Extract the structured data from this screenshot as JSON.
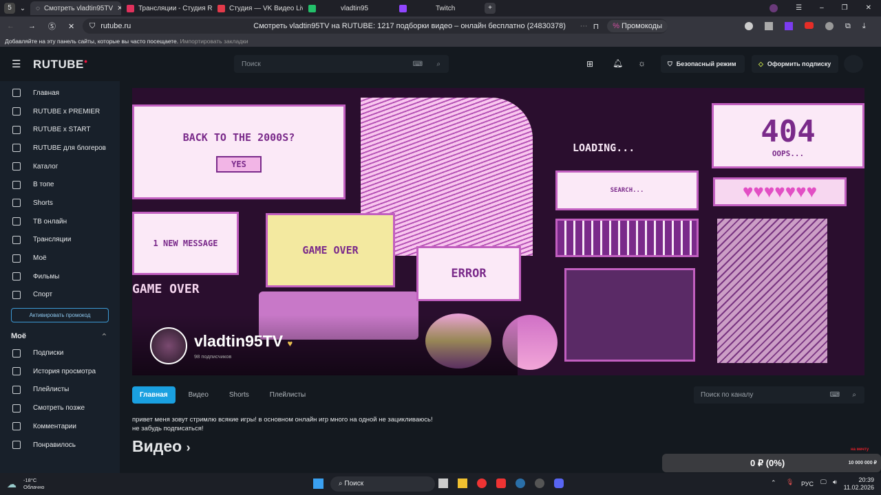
{
  "browser": {
    "tab_count": "5",
    "tabs": [
      {
        "label": "Смотреть vladtin95TV",
        "color": "#ffffff"
      },
      {
        "label": "Трансляции - Студия RUTUBE",
        "color": "#e0315c"
      },
      {
        "label": "Студия — VK Видео Live",
        "color": "#e33a4a"
      },
      {
        "label": "vladtin95",
        "color": "#23c06a"
      },
      {
        "label": "Twitch",
        "color": "#9146ff"
      }
    ],
    "url": "rutube.ru",
    "page_title": "Смотреть vladtin95TV на RUTUBE: 1217 подборки видео – онлайн бесплатно (24830378)",
    "promo": "Промокоды",
    "bookmarks_hint": "Добавляйте на эту панель сайты, которые вы часто посещаете.",
    "import_link": "Импортировать закладки"
  },
  "header": {
    "logo": "RUTUBE",
    "search_placeholder": "Поиск",
    "safe_mode": "Безопасный режим",
    "subscribe": "Оформить подписку"
  },
  "sidebar": {
    "items": [
      "Главная",
      "RUTUBE x PREMIER",
      "RUTUBE x START",
      "RUTUBE для блогеров",
      "Каталог",
      "В топе",
      "Shorts",
      "ТВ онлайн",
      "Трансляции",
      "Моё",
      "Фильмы",
      "Спорт"
    ],
    "promo_button": "Активировать промокод",
    "my_title": "Моё",
    "my_items": [
      "Подписки",
      "История просмотра",
      "Плейлисты",
      "Смотреть позже",
      "Комментарии",
      "Понравилось"
    ]
  },
  "banner": {
    "back": "BACK TO THE 2000S?",
    "yes": "YES",
    "loading": "LOADING...",
    "e404": "404",
    "oops": "OOPS...",
    "search": "SEARCH...",
    "message": "1 NEW MESSAGE",
    "game_over": "GAME OVER",
    "error": "ERROR"
  },
  "channel": {
    "name": "vladtin95TV",
    "subscribers": "98 подписчиков",
    "tabs": [
      "Главная",
      "Видео",
      "Shorts",
      "Плейлисты"
    ],
    "search_placeholder": "Поиск по каналу",
    "description_1": "привет меня зовут стримлю всякие игры! в основном онлайн игр много на одной не зацикливаюсь!",
    "description_2": "не забудь подписаться!",
    "videos_heading": "Видео"
  },
  "donation": {
    "amount": "0 ₽ (0%)",
    "goal": "10 000 000 ₽",
    "label": "на мечту",
    "progress_percent": 0
  },
  "taskbar": {
    "temp": "-18°C",
    "weather": "Облачно",
    "search": "Поиск",
    "lang": "РУС",
    "time": "20:39",
    "date": "11.02.2026"
  }
}
